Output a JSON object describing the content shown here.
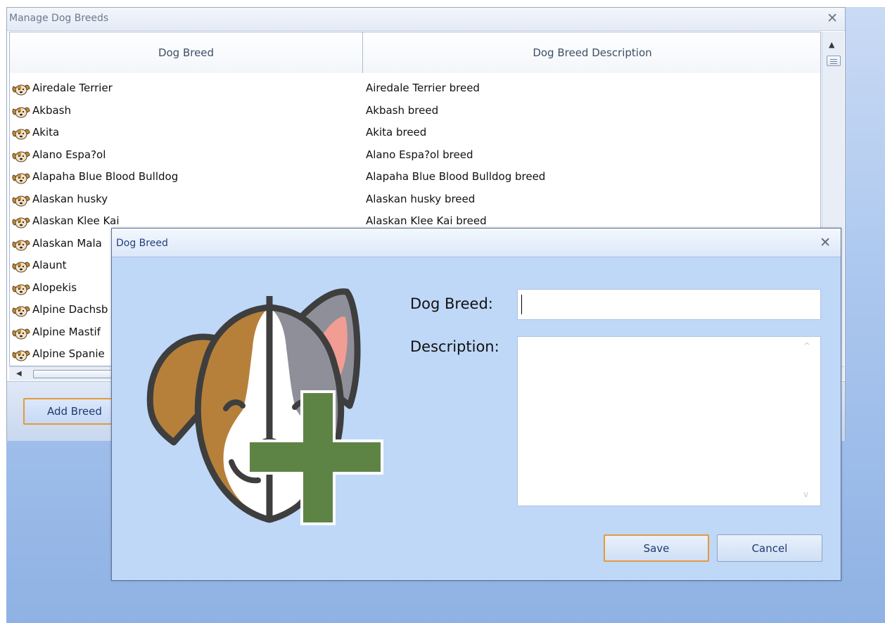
{
  "main_window": {
    "title": "Manage Dog Breeds",
    "close_glyph": "✕",
    "grid": {
      "columns": [
        "Dog Breed",
        "Dog Breed Description"
      ],
      "row_icon": "dog-icon",
      "rows": [
        {
          "breed": "Airedale Terrier",
          "description": "Airedale Terrier breed"
        },
        {
          "breed": "Akbash",
          "description": "Akbash breed"
        },
        {
          "breed": "Akita",
          "description": "Akita breed"
        },
        {
          "breed": "Alano Espa?ol",
          "description": "Alano Espa?ol breed"
        },
        {
          "breed": "Alapaha Blue Blood Bulldog",
          "description": "Alapaha Blue Blood Bulldog breed"
        },
        {
          "breed": "Alaskan husky",
          "description": "Alaskan husky breed"
        },
        {
          "breed": "Alaskan Klee Kai",
          "description": "Alaskan Klee Kai breed"
        },
        {
          "breed": "Alaskan Mala",
          "description": ""
        },
        {
          "breed": "Alaunt",
          "description": ""
        },
        {
          "breed": "Alopekis",
          "description": ""
        },
        {
          "breed": "Alpine Dachsb",
          "description": ""
        },
        {
          "breed": "Alpine Mastif",
          "description": ""
        },
        {
          "breed": "Alpine Spanie",
          "description": ""
        }
      ]
    },
    "add_button_label": "Add Breed"
  },
  "dialog": {
    "title": "Dog Breed",
    "close_glyph": "✕",
    "breed_label": "Dog Breed:",
    "breed_value": "",
    "description_label": "Description:",
    "description_value": "",
    "save_label": "Save",
    "cancel_label": "Cancel",
    "illustration": "dog-add-icon"
  },
  "colors": {
    "accent_border": "#e49a3a",
    "dialog_bg": "#bfd8f8",
    "plus_green": "#5e8445",
    "dog_brown": "#b6803b"
  }
}
